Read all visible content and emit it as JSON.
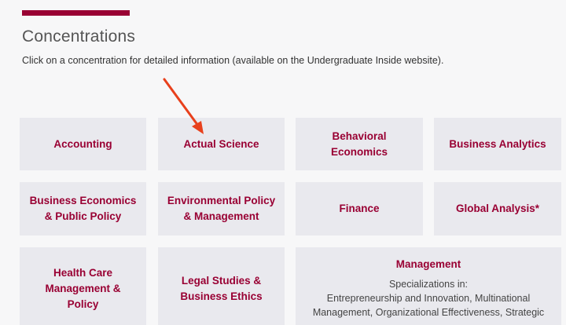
{
  "heading": "Concentrations",
  "intro": "Click on a concentration for detailed information (available on the Undergraduate Inside website).",
  "colors": {
    "accent": "#990033",
    "tile_bg": "#e9e9ee",
    "arrow": "#e8401c"
  },
  "tiles": [
    {
      "lines": [
        "Accounting"
      ]
    },
    {
      "lines": [
        "Actual Science"
      ]
    },
    {
      "lines": [
        "Behavioral",
        "Economics"
      ]
    },
    {
      "lines": [
        "Business Analytics"
      ]
    },
    {
      "lines": [
        "Business Economics",
        "& Public Policy"
      ]
    },
    {
      "lines": [
        "Environmental Policy",
        "& Management"
      ]
    },
    {
      "lines": [
        "Finance"
      ]
    },
    {
      "lines": [
        "Global Analysis*"
      ]
    },
    {
      "lines": [
        "Health Care",
        "Management &",
        "Policy"
      ]
    },
    {
      "lines": [
        "Legal Studies &",
        "Business Ethics"
      ]
    },
    {
      "lines": [
        "Management"
      ],
      "sub_heading": "Specializations in:",
      "sub_lines": [
        "Entrepreneurship and Innovation, Multinational",
        "Management, Organizational Effectiveness, Strategic"
      ]
    }
  ],
  "annotation": {
    "icon": "red-arrow-icon"
  }
}
